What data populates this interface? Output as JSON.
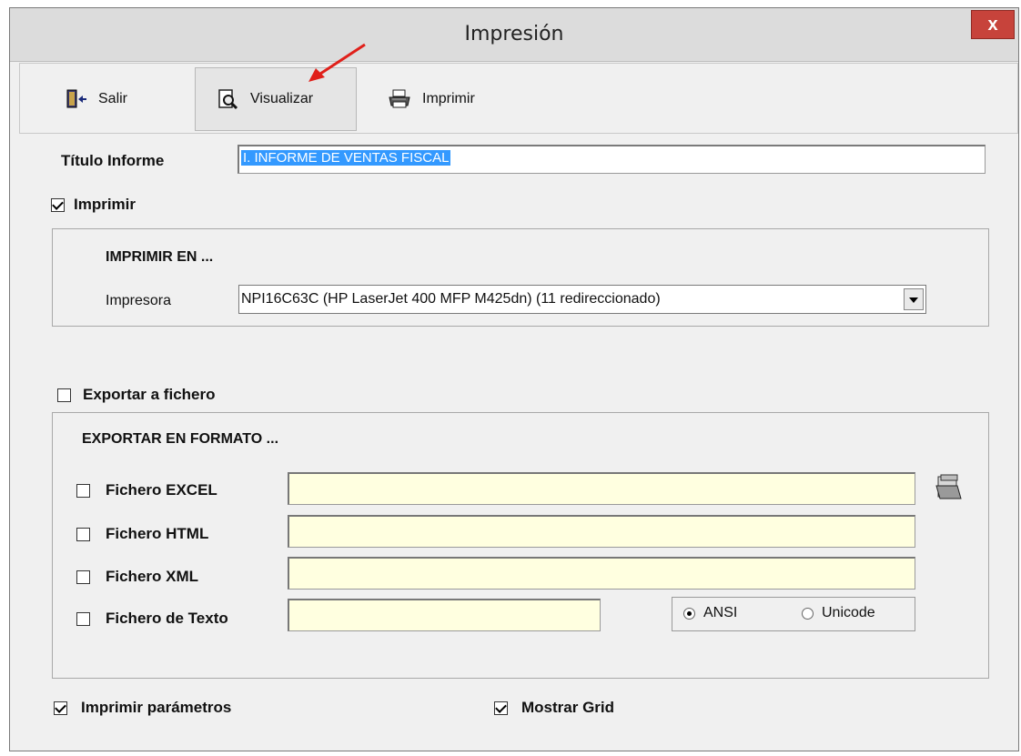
{
  "window": {
    "title": "Impresión",
    "close_label": "x"
  },
  "toolbar": {
    "exit_label": "Salir",
    "preview_label": "Visualizar",
    "print_label": "Imprimir"
  },
  "report_title": {
    "label": "Título Informe",
    "value": "I. INFORME DE VENTAS FISCAL"
  },
  "print": {
    "checkbox_label": "Imprimir",
    "checked": true,
    "group_title": "IMPRIMIR EN ...",
    "printer_label": "Impresora",
    "printer_value": "NPI16C63C (HP LaserJet 400 MFP M425dn) (11 redireccionado)"
  },
  "export": {
    "checkbox_label": "Exportar a fichero",
    "checked": false,
    "group_title": "EXPORTAR EN FORMATO ...",
    "excel_label": "Fichero EXCEL",
    "html_label": "Fichero HTML",
    "xml_label": "Fichero XML",
    "text_label": "Fichero de Texto",
    "encoding_ansi": "ANSI",
    "encoding_unicode": "Unicode",
    "selected_encoding": "ANSI"
  },
  "options": {
    "print_params_label": "Imprimir parámetros",
    "print_params_checked": true,
    "show_grid_label": "Mostrar Grid",
    "show_grid_checked": true
  },
  "colors": {
    "input_bg": "#ffffe0",
    "close_red": "#c7433b",
    "selection_blue": "#3399ff",
    "arrow_red": "#e0201a"
  }
}
